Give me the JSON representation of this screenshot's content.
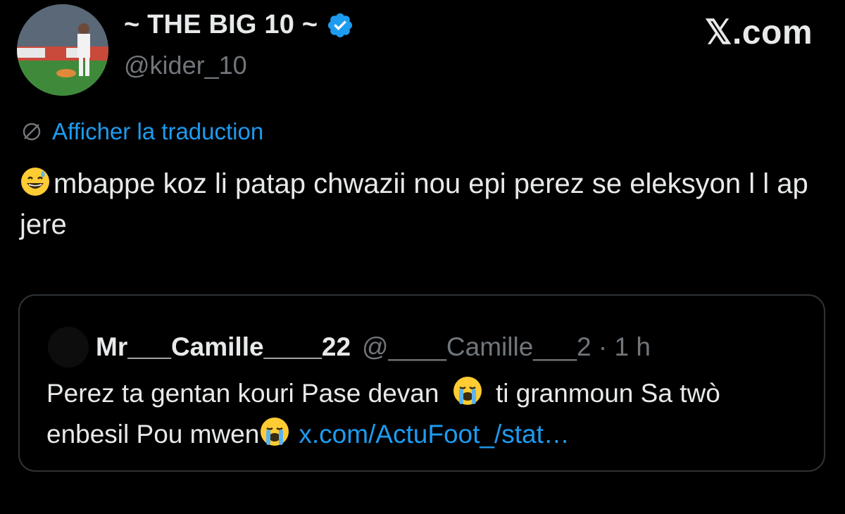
{
  "profile": {
    "display_name": "~ THE BIG 10 ~",
    "handle": "@kider_10",
    "verified": true
  },
  "brand": "𝕏.com",
  "translate_label": "Afficher la traduction",
  "tweet": {
    "emoji": "grinning-face-with-sweat",
    "text": "mbappe koz li patap chwazii nou epi perez se eleksyon l l ap jere"
  },
  "quoted_tweet": {
    "name": "Mr___Camille____22",
    "handle_time": "@____Camille___2 · 1 h",
    "text_part1": "Perez ta gentan kouri Pase devan",
    "text_part2": "ti granmoun Sa twò enbesil  Pou mwen",
    "link": "x.com/ActuFoot_/stat…"
  },
  "colors": {
    "background": "#000000",
    "text": "#e7e9ea",
    "muted": "#71767b",
    "accent": "#1d9bf0",
    "border": "#2f3336"
  }
}
